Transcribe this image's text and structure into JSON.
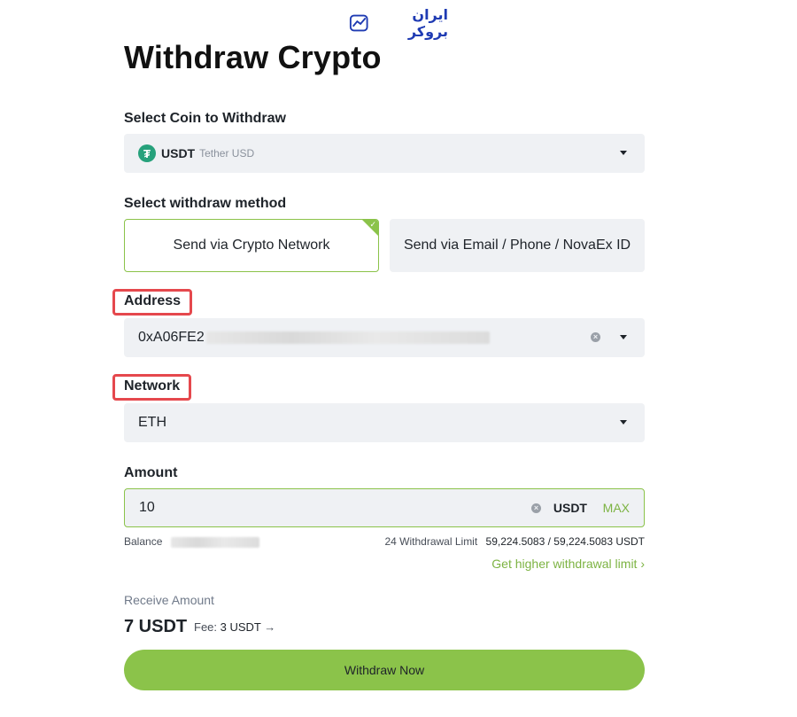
{
  "logo": {
    "text": "ایران بروکر"
  },
  "page_title": "Withdraw Crypto",
  "coin": {
    "label": "Select Coin to Withdraw",
    "symbol": "USDT",
    "name": "Tether USD",
    "icon_glyph": "₮",
    "icon_color": "#26a17b"
  },
  "method": {
    "label": "Select withdraw method",
    "options": [
      "Send via Crypto Network",
      "Send via Email / Phone / NovaEx ID"
    ],
    "selected": 0
  },
  "address": {
    "label": "Address",
    "value_prefix": "0xA06FE2"
  },
  "network": {
    "label": "Network",
    "value": "ETH"
  },
  "amount": {
    "label": "Amount",
    "value": "10",
    "unit": "USDT",
    "max_label": "MAX"
  },
  "balance": {
    "label": "Balance"
  },
  "limit": {
    "label": "24 Withdrawal Limit",
    "value": "59,224.5083 / 59,224.5083 USDT"
  },
  "higher_limit_link": "Get higher withdrawal limit",
  "receive": {
    "label": "Receive Amount",
    "value": "7 USDT",
    "fee_label": "Fee:",
    "fee_value": "3 USDT"
  },
  "withdraw_button": "Withdraw Now",
  "colors": {
    "accent": "#8bc34a",
    "highlight_box": "#e5484d",
    "field_bg": "#eff1f4"
  }
}
